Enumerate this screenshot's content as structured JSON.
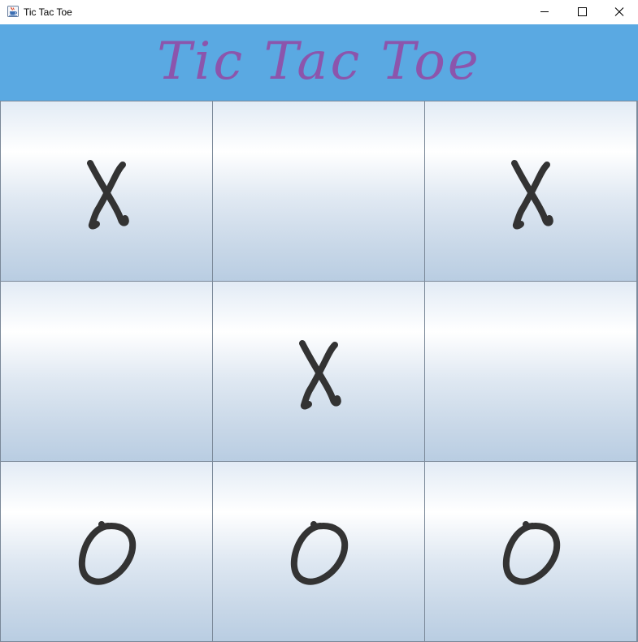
{
  "window": {
    "title": "Tic Tac Toe",
    "icon": "java-cup-icon",
    "controls": [
      "minimize-icon",
      "maximize-icon",
      "close-icon"
    ]
  },
  "header": {
    "title": "Tic Tac Toe"
  },
  "board": {
    "cells": [
      {
        "row": 1,
        "col": 1,
        "mark": "X"
      },
      {
        "row": 1,
        "col": 2,
        "mark": ""
      },
      {
        "row": 1,
        "col": 3,
        "mark": "X"
      },
      {
        "row": 2,
        "col": 1,
        "mark": ""
      },
      {
        "row": 2,
        "col": 2,
        "mark": "X"
      },
      {
        "row": 2,
        "col": 3,
        "mark": ""
      },
      {
        "row": 3,
        "col": 1,
        "mark": "O"
      },
      {
        "row": 3,
        "col": 2,
        "mark": "O"
      },
      {
        "row": 3,
        "col": 3,
        "mark": "O"
      }
    ]
  },
  "colors": {
    "banner": "#5aa9e2",
    "title_text": "#8c55ac",
    "mark": "#333333"
  }
}
